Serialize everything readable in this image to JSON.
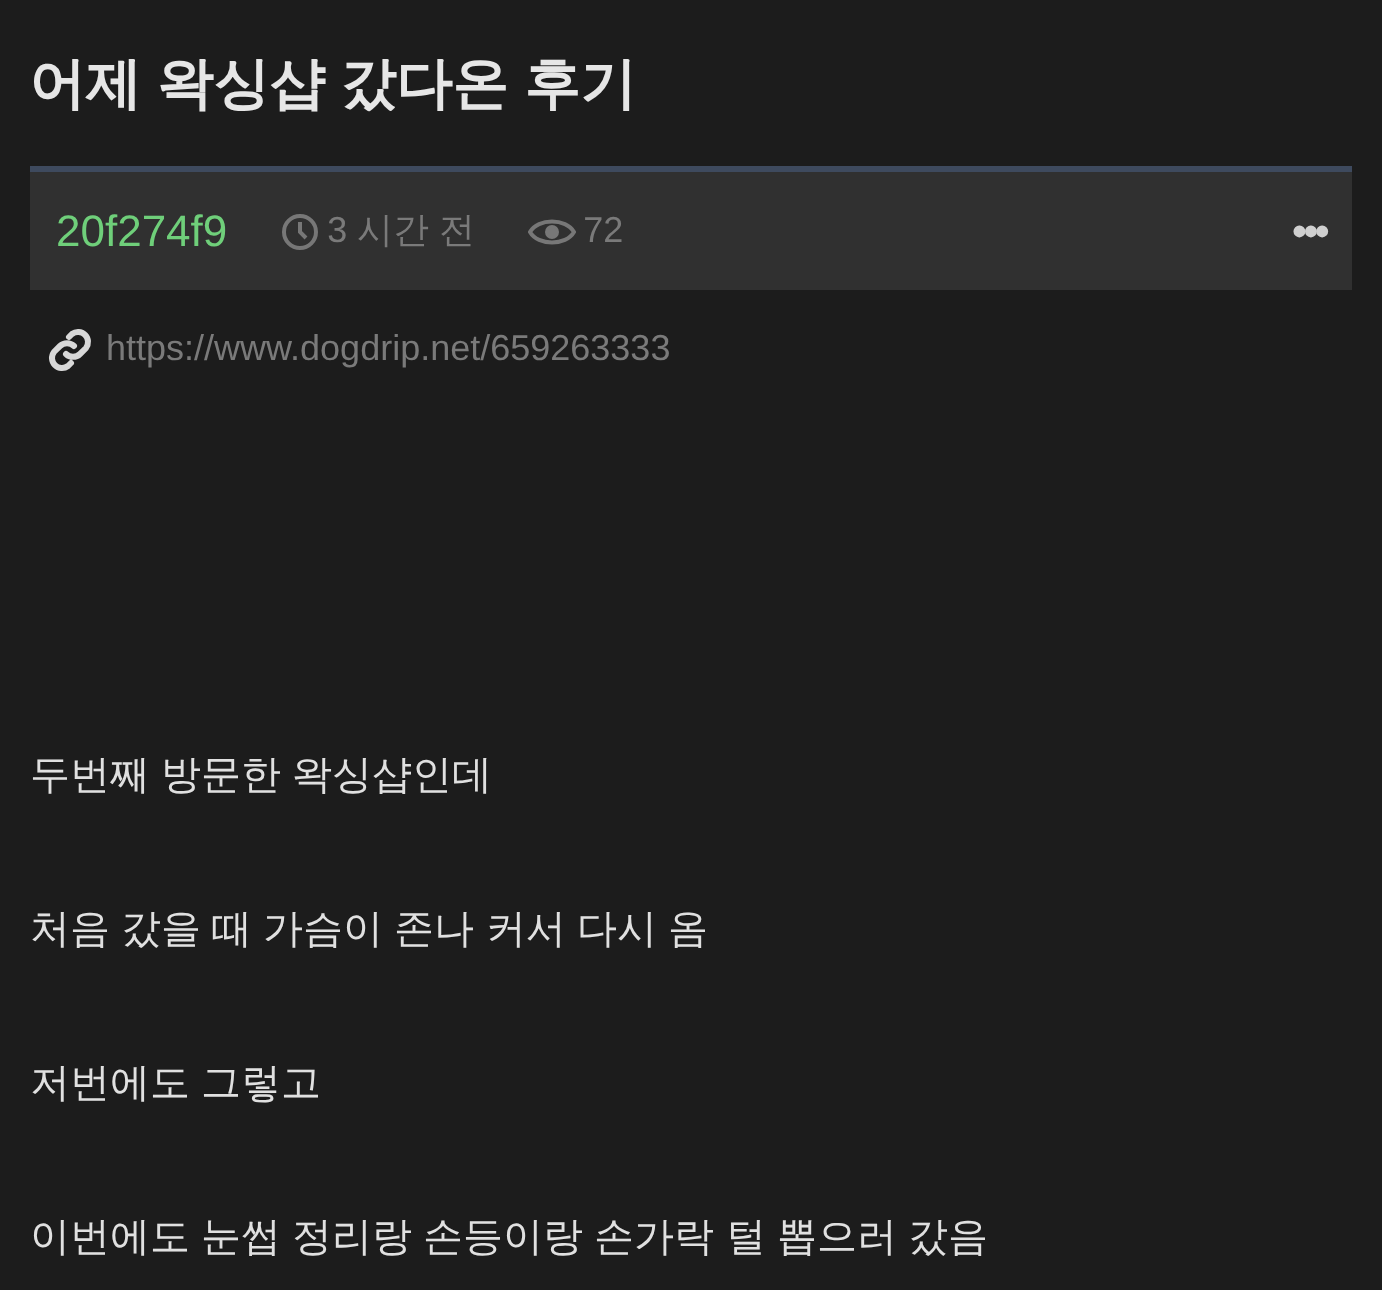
{
  "post": {
    "title": "어제 왁싱샵 갔다온 후기",
    "author": "20f274f9",
    "time": "3 시간 전",
    "views": "72",
    "more": "•••",
    "link": "https://www.dogdrip.net/659263333",
    "paragraphs": [
      "두번째 방문한 왁싱샵인데",
      "처음 갔을 때 가슴이 존나 커서 다시 옴",
      "저번에도 그렇고",
      "이번에도 눈썹 정리랑 손등이랑 손가락 털 뽑으러 갔음"
    ]
  }
}
